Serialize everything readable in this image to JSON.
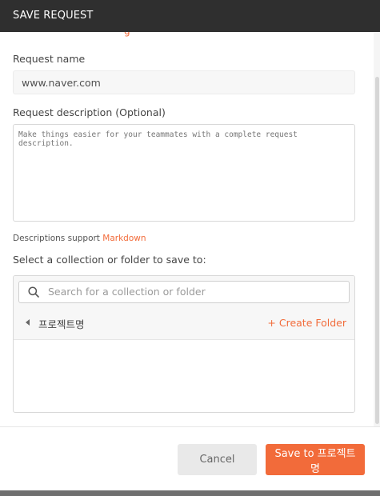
{
  "dialog": {
    "title": "SAVE REQUEST"
  },
  "top_cut_text": "g",
  "request_name": {
    "label": "Request name",
    "value": "www.naver.com"
  },
  "request_description": {
    "label": "Request description (Optional)",
    "placeholder": "Make things easier for your teammates with a complete request description."
  },
  "descriptions_support": {
    "text": "Descriptions support ",
    "link": "Markdown"
  },
  "collection": {
    "label": "Select a collection or folder to save to:",
    "search_placeholder": "Search for a collection or folder",
    "current_folder": "프로젝트명",
    "create_folder": "+ Create Folder"
  },
  "footer": {
    "cancel_label": "Cancel",
    "save_label": "Save to 프로젝트명"
  },
  "colors": {
    "accent": "#f26b3a",
    "titlebar": "#2f2f2f"
  },
  "icons": {
    "search": "search-icon",
    "back": "caret-left-icon"
  }
}
